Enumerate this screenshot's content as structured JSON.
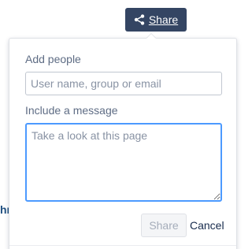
{
  "background": {
    "fragment_text": "hr"
  },
  "share_trigger": {
    "label": "Share",
    "icon": "share-icon"
  },
  "dialog": {
    "add_people_label": "Add people",
    "add_people_placeholder": "User name, group or email",
    "add_people_value": "",
    "message_label": "Include a message",
    "message_placeholder": "Take a look at this page",
    "message_value": "",
    "share_button_label": "Share",
    "share_button_enabled": false,
    "cancel_label": "Cancel"
  },
  "colors": {
    "trigger_bg": "#344563",
    "focus_border": "#4c9aff",
    "label_text": "#5e6c84",
    "disabled_text": "#a5adba"
  }
}
